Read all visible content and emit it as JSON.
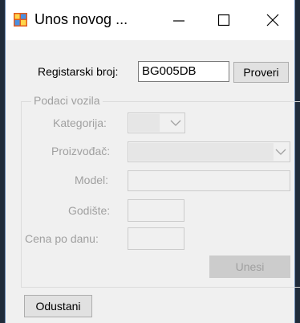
{
  "window": {
    "title": "Unos novog ...",
    "minimize_label": "—",
    "maximize_label": "☐",
    "close_label": "✕",
    "icon": "app-form-icon"
  },
  "form": {
    "reg_label": "Registarski broj:",
    "reg_value": "BG005DB",
    "check_button": "Proveri",
    "group_title": "Podaci vozila",
    "category_label": "Kategorija:",
    "manufacturer_label": "Proizvođač:",
    "model_label": "Model:",
    "year_label": "Godište:",
    "price_label": "Cena po danu:",
    "submit_button": "Unesi",
    "cancel_button": "Odustani"
  }
}
